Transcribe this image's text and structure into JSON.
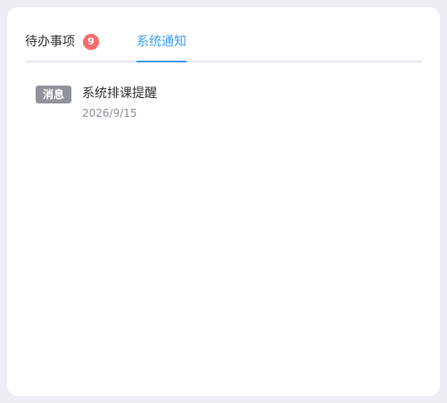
{
  "tabs": {
    "todo": {
      "label": "待办事项",
      "badge": "9"
    },
    "notify": {
      "label": "系统通知"
    }
  },
  "messages": [
    {
      "tag": "消息",
      "title": "系统排课提醒",
      "date": "2026/9/15"
    }
  ],
  "colors": {
    "accent": "#409eff",
    "badge": "#f56c6c",
    "tag": "#909399"
  }
}
